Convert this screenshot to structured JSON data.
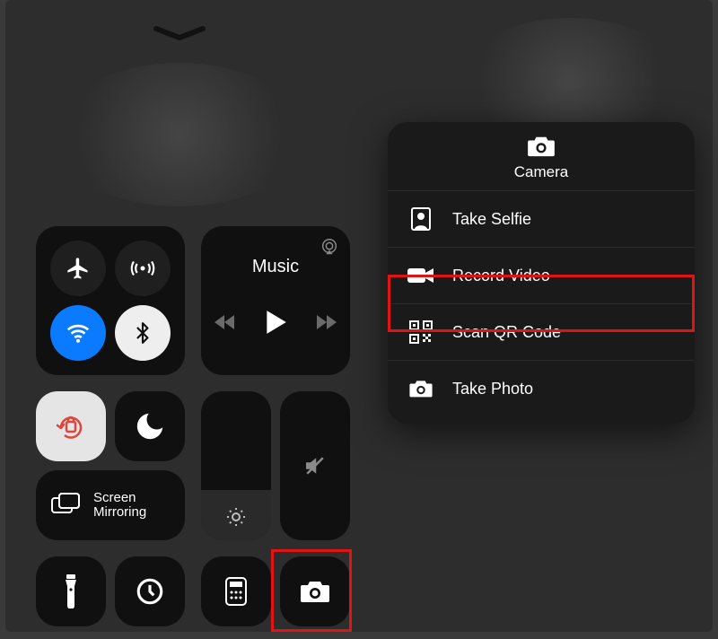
{
  "connectivity": {
    "airplane": "airplane-icon",
    "cellular": "cellular-icon",
    "wifi": "wifi-icon",
    "bluetooth": "bluetooth-icon"
  },
  "music": {
    "title": "Music"
  },
  "screen_mirroring": {
    "label": "Screen\nMirroring"
  },
  "camera_menu": {
    "title": "Camera",
    "items": [
      {
        "id": "selfie",
        "label": "Take Selfie"
      },
      {
        "id": "record",
        "label": "Record Video"
      },
      {
        "id": "qr",
        "label": "Scan QR Code"
      },
      {
        "id": "photo",
        "label": "Take Photo"
      }
    ]
  }
}
